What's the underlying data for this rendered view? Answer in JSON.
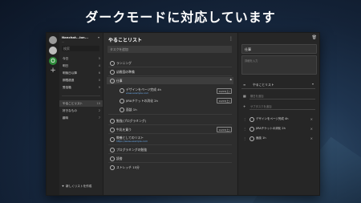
{
  "banner": {
    "title": "ダークモードに対応しています"
  },
  "rail": {
    "avatar_initial": "O",
    "add": "+"
  },
  "sidebar": {
    "account_name": "Nanchat...ion...",
    "account_sub": "...",
    "search_placeholder": "検索",
    "items": [
      {
        "label": "今日",
        "count": "5"
      },
      {
        "label": "明日",
        "count": "4"
      },
      {
        "label": "明後日以降",
        "count": "6"
      },
      {
        "label": "期限超過",
        "count": "0"
      },
      {
        "label": "受信箱",
        "count": "9"
      }
    ],
    "lists": [
      {
        "label": "やることリスト",
        "count": "10",
        "active": true
      },
      {
        "label": "好きなもの",
        "count": "2"
      },
      {
        "label": "趣味",
        "count": "7"
      }
    ],
    "new_list": "新しくリストを作成"
  },
  "main": {
    "title": "やることリスト",
    "add_placeholder": "タスクを追加",
    "tasks": [
      {
        "text": "ランニング"
      },
      {
        "text": "幼稚園の準備"
      },
      {
        "text": "仕事",
        "expanded": true,
        "subtasks": [
          {
            "text": "デザインをページ完成 4h",
            "link": "www.example.com",
            "tag": "14/03(土)"
          },
          {
            "text": "JIRAチケットの消化 2h",
            "tag": "14/03(土)"
          },
          {
            "text": "面談 1h"
          }
        ]
      },
      {
        "text": "勉強(プログラミング)"
      },
      {
        "text": "牛乳を買う",
        "tag": "14/03(土)"
      },
      {
        "text": "教養としてのリスト",
        "link": "https://www.example.com"
      },
      {
        "text": "プログラミングの勉強"
      },
      {
        "text": "読書"
      },
      {
        "text": "ストレッチ 15分"
      }
    ]
  },
  "detail": {
    "task_title": "仕事",
    "memo_placeholder": "詳細を入力",
    "list_name": "やることリスト",
    "due_placeholder": "期日を追加",
    "subtask_placeholder": "サブタスクを追加",
    "subtasks": [
      {
        "text": "デザインをページ完成 4h"
      },
      {
        "text": "JIRAチケットの消化 2h"
      },
      {
        "text": "面談 1h"
      }
    ]
  }
}
